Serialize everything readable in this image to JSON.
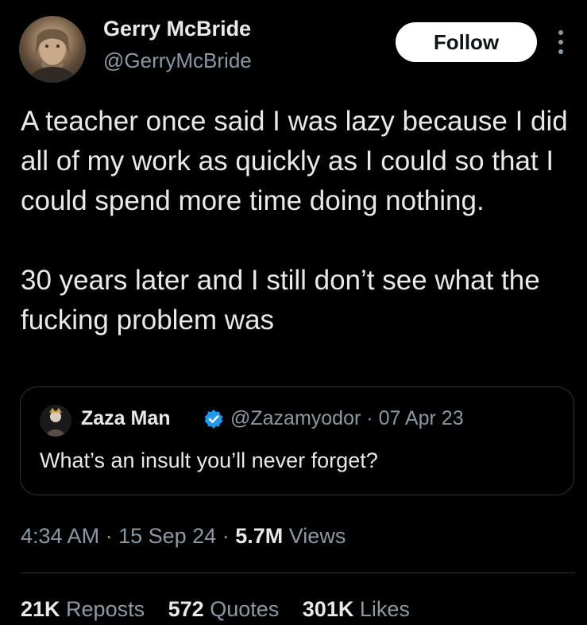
{
  "author": {
    "name": "Gerry McBride",
    "handle": "@GerryMcBride",
    "avatar_icon": "profile-photo"
  },
  "follow_button": {
    "label": "Follow"
  },
  "more_icon": "more-vertical-icon",
  "tweet": {
    "paragraphs": [
      "A teacher once said I was lazy because I did all of my work as quickly as I could so that I could spend more time doing nothing.",
      "30 years later and I still don’t see what the fucking problem was"
    ]
  },
  "quote": {
    "name": "Zaza Man",
    "verified": true,
    "handle": "@Zazamyodor",
    "separator": "·",
    "date": "07 Apr 23",
    "text": "What’s an insult you’ll never forget?"
  },
  "meta": {
    "time": "4:34 AM",
    "date": "15 Sep 24",
    "separator": "·",
    "views_count": "5.7M",
    "views_label": "Views"
  },
  "stats": {
    "reposts_count": "21K",
    "reposts_label": "Reposts",
    "quotes_count": "572",
    "quotes_label": "Quotes",
    "likes_count": "301K",
    "likes_label": "Likes"
  },
  "colors": {
    "background": "#000000",
    "primary_text": "#e7e9ea",
    "secondary_text": "#8b98a5",
    "border": "#2f3336",
    "verified_blue": "#1d9bf0",
    "follow_bg": "#ffffff"
  }
}
